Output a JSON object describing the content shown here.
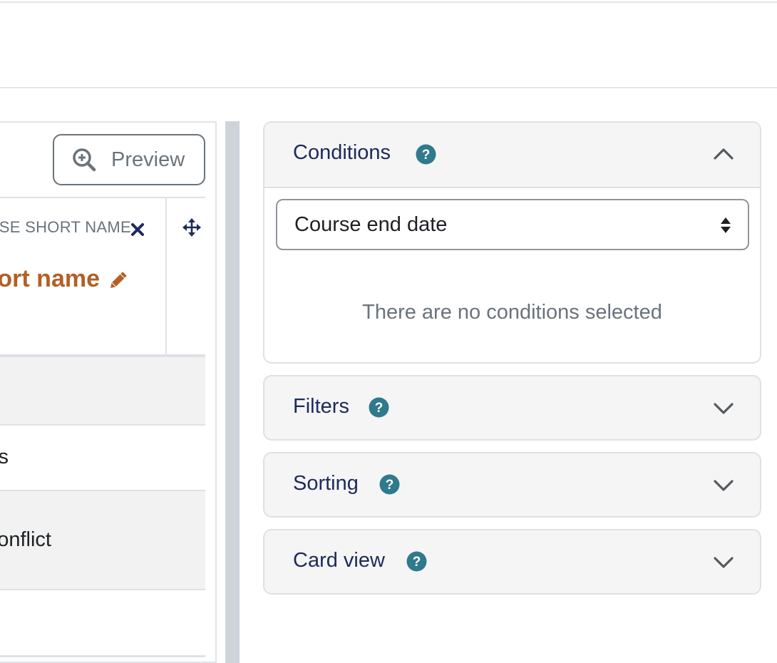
{
  "report": {
    "preview_label": "Preview",
    "column": {
      "header_label": "COURSE SHORT NAME",
      "name": "Course short name"
    },
    "rows": [
      {
        "text": ""
      },
      {
        "text": "s"
      },
      {
        "text": "onflict"
      },
      {
        "text": ""
      }
    ]
  },
  "sidebar": {
    "conditions": {
      "title": "Conditions",
      "select_value": "Course end date",
      "empty_message": "There are no conditions selected",
      "expanded": true
    },
    "filters": {
      "title": "Filters",
      "expanded": false
    },
    "sorting": {
      "title": "Sorting",
      "expanded": false
    },
    "card_view": {
      "title": "Card view",
      "expanded": false
    }
  },
  "colors": {
    "accent_text": "#1d2a5b",
    "help_icon": "#2f7a8c",
    "column_name": "#b35f25",
    "move_icon": "#1d2a5b"
  },
  "icons": [
    "zoom-in-icon",
    "close-icon",
    "move-icon",
    "pencil-icon",
    "help-icon",
    "chevron-up-icon",
    "chevron-down-icon",
    "select-arrows-icon"
  ]
}
